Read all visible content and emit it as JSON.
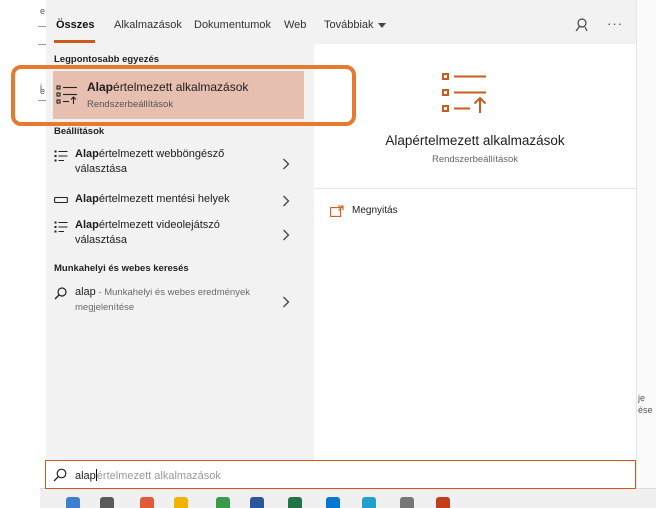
{
  "colors": {
    "accent": "#cc5a1d",
    "highlight_ring": "#e67a2e",
    "selected_bg": "#e6bfb0",
    "panel_bg": "#f2f2f2"
  },
  "tabs": {
    "items": [
      {
        "label": "Összes",
        "active": true
      },
      {
        "label": "Alkalmazások"
      },
      {
        "label": "Dokumentumok"
      },
      {
        "label": "Web"
      },
      {
        "label": "Továbbiak"
      }
    ],
    "feedback_icon": "feedback-icon",
    "more_icon": "ellipsis-icon",
    "more_label": "···"
  },
  "best_match": {
    "section_label": "Legpontosabb egyezés",
    "title_bold": "Alap",
    "title_rest": "értelmezett alkalmazások",
    "subtitle": "Rendszerbeállítások",
    "icon": "default-apps-icon"
  },
  "settings": {
    "section_label": "Beállítások",
    "items": [
      {
        "bold": "Alap",
        "rest": "értelmezett webböngésző",
        "line2": "választása",
        "icon": "list-icon"
      },
      {
        "bold": "Alap",
        "rest": "értelmezett mentési helyek",
        "icon": "storage-icon"
      },
      {
        "bold": "Alap",
        "rest": "értelmezett videolejátszó",
        "line2": "választása",
        "icon": "list-icon"
      }
    ]
  },
  "web": {
    "section_label": "Munkahelyi és webes keresés",
    "query": "alap",
    "description_line1": " - Munkahelyi és webes eredmények",
    "description_line2": "megjelenítése",
    "icon": "search-icon"
  },
  "preview": {
    "title": "Alapértelmezett alkalmazások",
    "subtitle": "Rendszerbeállítások",
    "open_label": "Megnyitás",
    "open_icon": "open-window-icon"
  },
  "search": {
    "typed": "alap",
    "suggestion": "értelmezett alkalmazások",
    "icon": "search-icon"
  },
  "background": {
    "glyphs": [
      "e",
      "i",
      "e",
      "je",
      "ése"
    ]
  }
}
